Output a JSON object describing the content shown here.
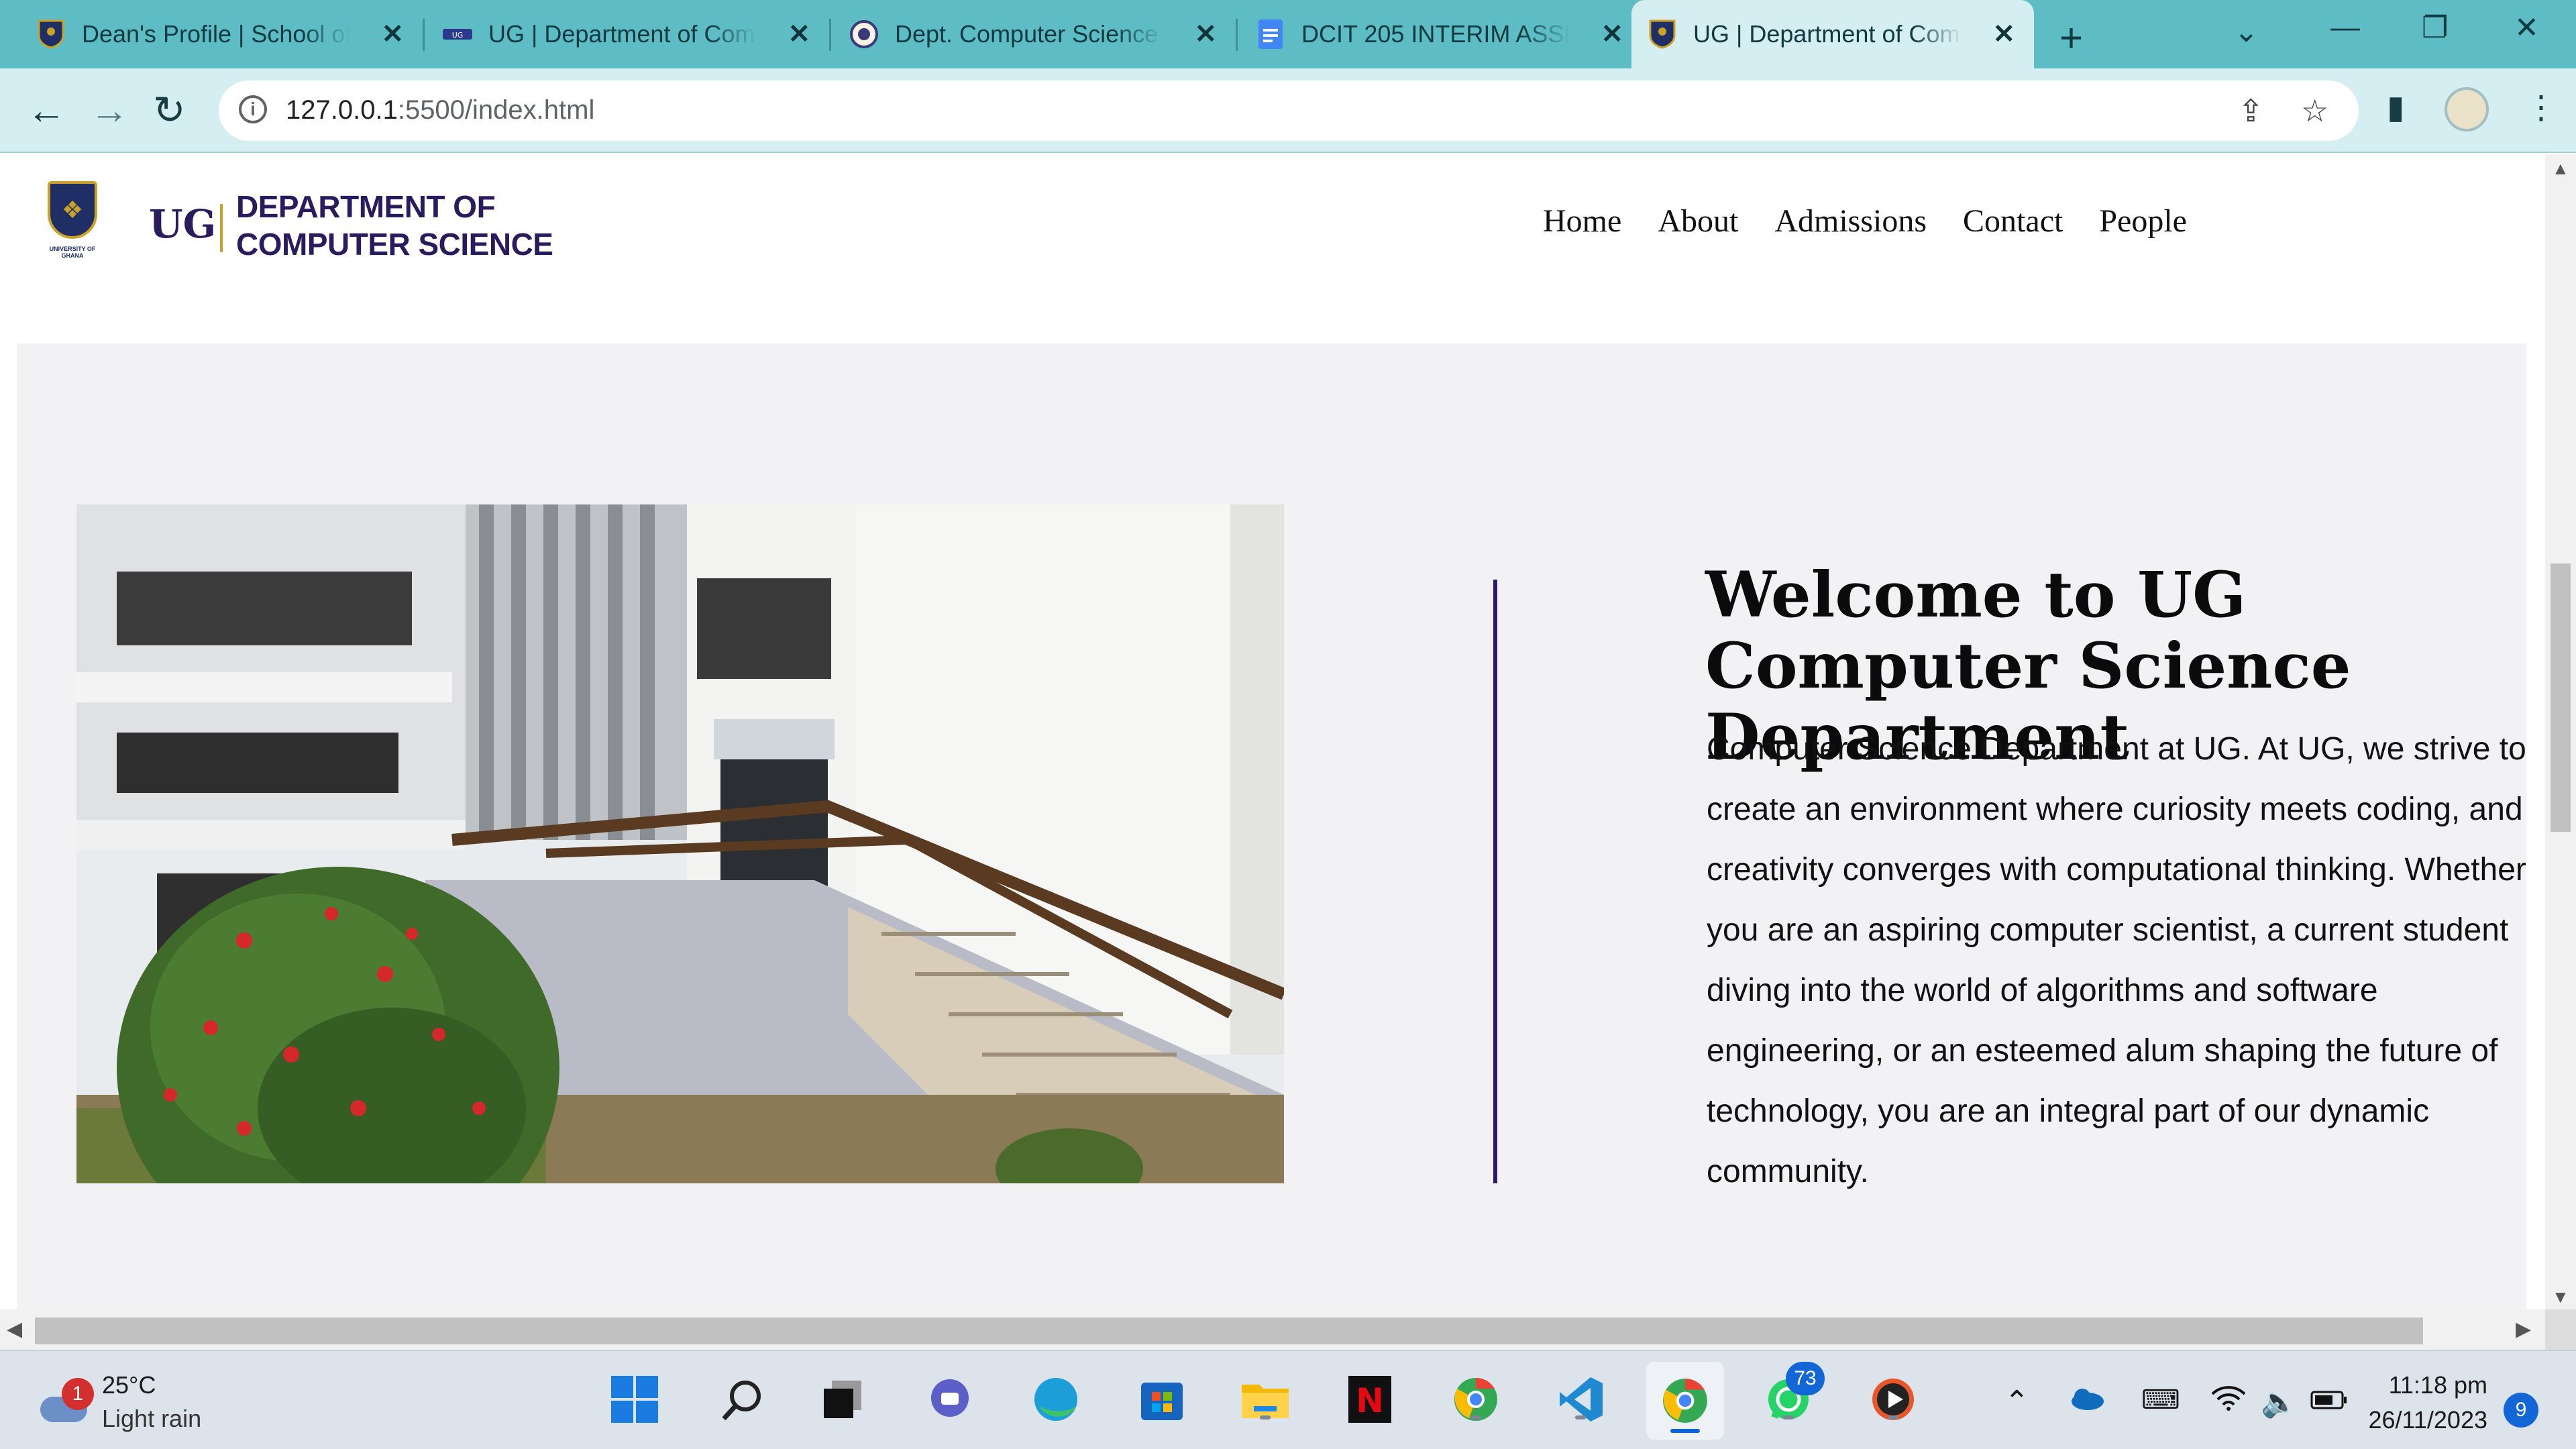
{
  "browser": {
    "tabs": [
      {
        "title": "Dean's Profile | School of",
        "icon": "ug-crest-favicon"
      },
      {
        "title": "UG | Department of Com",
        "icon": "ug-logo-favicon"
      },
      {
        "title": "Dept. Computer Science",
        "icon": "seal-favicon"
      },
      {
        "title": "DCIT 205 INTERIM ASSES",
        "icon": "google-docs-favicon"
      },
      {
        "title": "UG | Department of Com",
        "icon": "ug-crest-favicon",
        "active": true
      }
    ],
    "url_host": "127.0.0.1",
    "url_rest": ":5500/index.html",
    "accent": "#5ebcc5",
    "toolbar_bg": "#d4eef1"
  },
  "site": {
    "logo_short": "UG",
    "crest_caption": "UNIVERSITY OF GHANA",
    "dept_line1": "DEPARTMENT OF",
    "dept_line2": "COMPUTER SCIENCE",
    "nav": [
      "Home",
      "About",
      "Admissions",
      "Contact",
      "People"
    ],
    "brand_color": "#2a1a5e",
    "hero": {
      "title": "Welcome to UG Computer Science Department",
      "body": "Computer Science Department at UG. At UG, we strive to create an environment where curiosity meets coding, and creativity converges with computational thinking. Whether you are an aspiring computer scientist, a current student diving into the world of algorithms and software engineering, or an esteemed alum shaping the future of technology, you are an integral part of our dynamic community.",
      "bg": "#f2f2f4"
    }
  },
  "taskbar": {
    "weather": {
      "badge": "1",
      "temp": "25°C",
      "condition": "Light rain"
    },
    "apps": [
      "windows-start",
      "search",
      "task-view",
      "teams-chat",
      "edge",
      "microsoft-store",
      "file-explorer",
      "netflix",
      "chrome-profile-2",
      "vs-code",
      "chrome",
      "whatsapp",
      "media-player"
    ],
    "whatsapp_badge": "73",
    "time": "11:18 pm",
    "date": "26/11/2023",
    "notifications": "9"
  }
}
